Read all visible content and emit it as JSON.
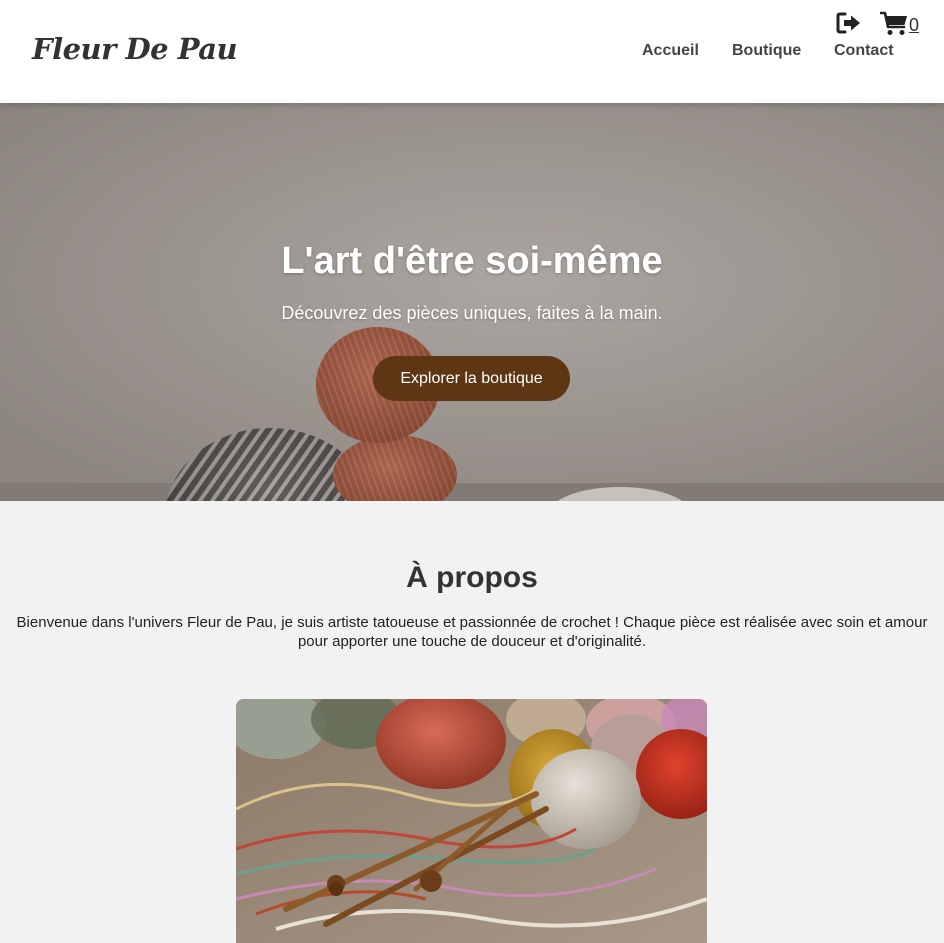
{
  "header": {
    "logo": "Fleur De Pau",
    "nav": {
      "home": "Accueil",
      "shop": "Boutique",
      "contact": "Contact"
    },
    "icons": {
      "logout": "logout-icon",
      "cart": "cart-icon"
    },
    "cart_count": "0"
  },
  "hero": {
    "title": "L'art d'être soi-même",
    "subtitle": "Découvrez des pièces uniques, faites à la main.",
    "cta": "Explorer la boutique"
  },
  "about": {
    "title": "À propos",
    "text": "Bienvenue dans l'univers Fleur de Pau, je suis artiste tatoueuse et passionnée de crochet ! Chaque pièce est réalisée avec soin et amour pour apporter une touche de douceur et d'originalité."
  },
  "colors": {
    "cta_background": "#5e3613",
    "page_background": "#f3f2f2",
    "header_background": "#ffffff",
    "text": "#333333"
  }
}
